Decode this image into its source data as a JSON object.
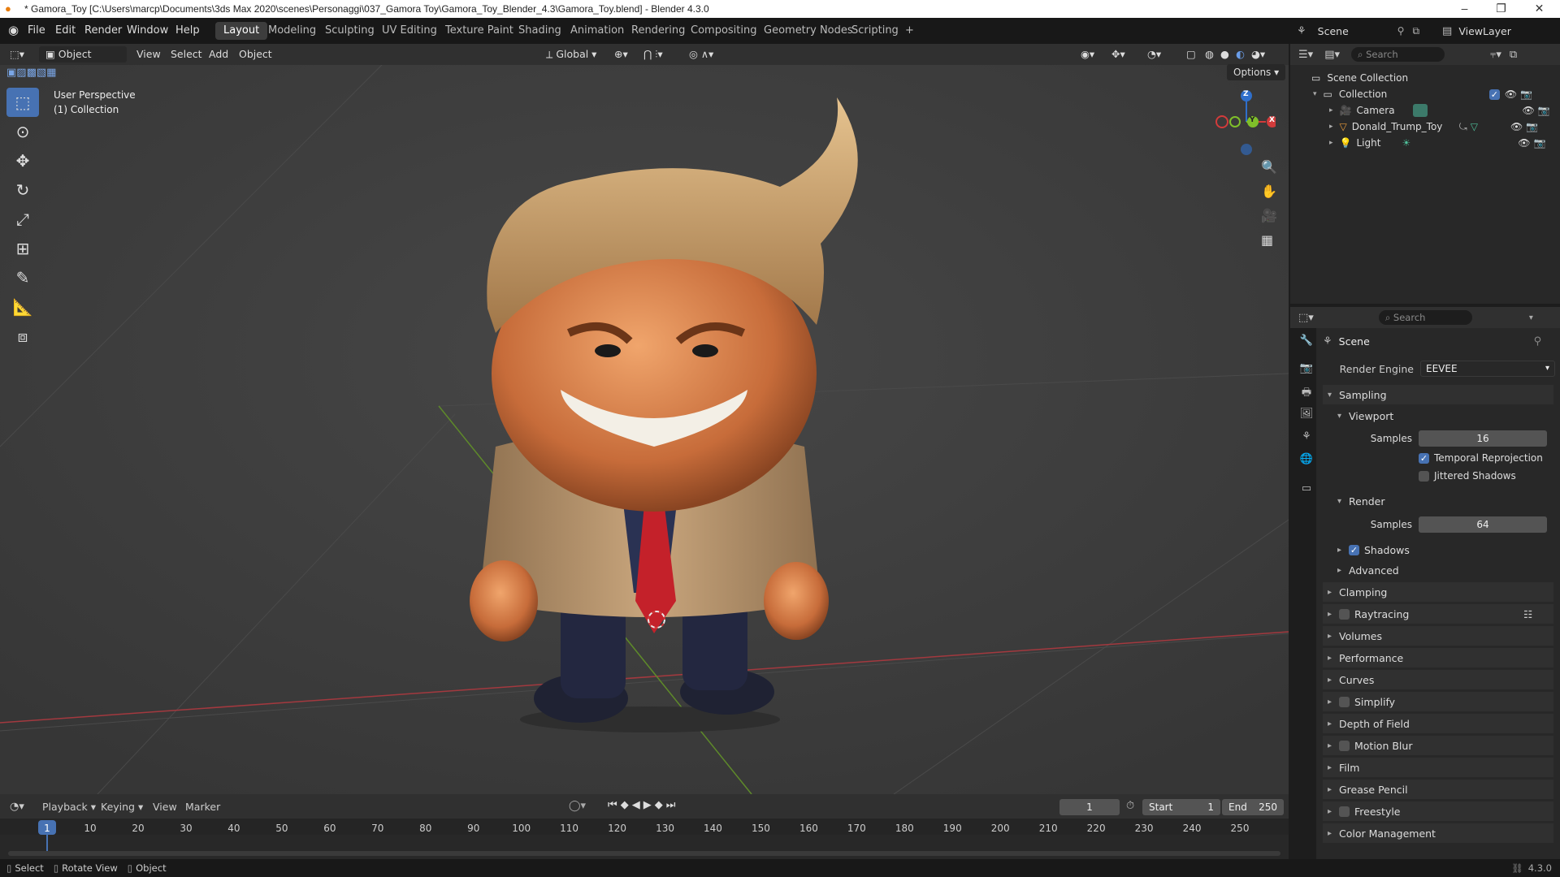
{
  "window": {
    "title": "* Gamora_Toy [C:\\Users\\marcp\\Documents\\3ds Max 2020\\scenes\\Personaggi\\037_Gamora Toy\\Gamora_Toy_Blender_4.3\\Gamora_Toy.blend] - Blender 4.3.0",
    "minimize": "–",
    "maximize": "❐",
    "close": "✕"
  },
  "menu": {
    "file": "File",
    "edit": "Edit",
    "render": "Render",
    "window": "Window",
    "help": "Help"
  },
  "workspaces": [
    "Layout",
    "Modeling",
    "Sculpting",
    "UV Editing",
    "Texture Paint",
    "Shading",
    "Animation",
    "Rendering",
    "Compositing",
    "Geometry Nodes",
    "Scripting",
    "+"
  ],
  "scene_selector": {
    "scene": "Scene",
    "view_layer": "ViewLayer"
  },
  "viewport_header": {
    "mode": "Object Mode",
    "view": "View",
    "select": "Select",
    "add": "Add",
    "object": "Object",
    "orientation": "Global",
    "options": "Options"
  },
  "viewport": {
    "perspective": "User Perspective",
    "collection": "(1) Collection"
  },
  "gizmo": {
    "z": "Z",
    "y": "Y",
    "x": "X"
  },
  "outliner": {
    "search_placeholder": "Search",
    "scene_collection": "Scene Collection",
    "collection": "Collection",
    "items": [
      "Camera",
      "Donald_Trump_Toy",
      "Light"
    ]
  },
  "properties": {
    "search_placeholder": "Search",
    "context": "Scene",
    "render_engine_label": "Render Engine",
    "render_engine": "EEVEE",
    "sampling": "Sampling",
    "viewport": "Viewport",
    "samples_label": "Samples",
    "viewport_samples": "16",
    "temporal_reprojection": "Temporal Reprojection",
    "jittered_shadows": "Jittered Shadows",
    "render": "Render",
    "render_samples": "64",
    "shadows": "Shadows",
    "advanced": "Advanced",
    "panels": [
      "Clamping",
      "Raytracing",
      "Volumes",
      "Performance",
      "Curves",
      "Simplify",
      "Depth of Field",
      "Motion Blur",
      "Film",
      "Grease Pencil",
      "Freestyle",
      "Color Management"
    ]
  },
  "timeline": {
    "playback": "Playback",
    "keying": "Keying",
    "view": "View",
    "marker": "Marker",
    "current_frame": "1",
    "start_label": "Start",
    "start": "1",
    "end_label": "End",
    "end": "250",
    "ticks": [
      "1",
      "10",
      "20",
      "30",
      "40",
      "50",
      "60",
      "70",
      "80",
      "90",
      "100",
      "110",
      "120",
      "130",
      "140",
      "150",
      "160",
      "170",
      "180",
      "190",
      "200",
      "210",
      "220",
      "230",
      "240",
      "250"
    ]
  },
  "status": {
    "select": "Select",
    "rotate_view": "Rotate View",
    "object": "Object",
    "version": "4.3.0"
  }
}
